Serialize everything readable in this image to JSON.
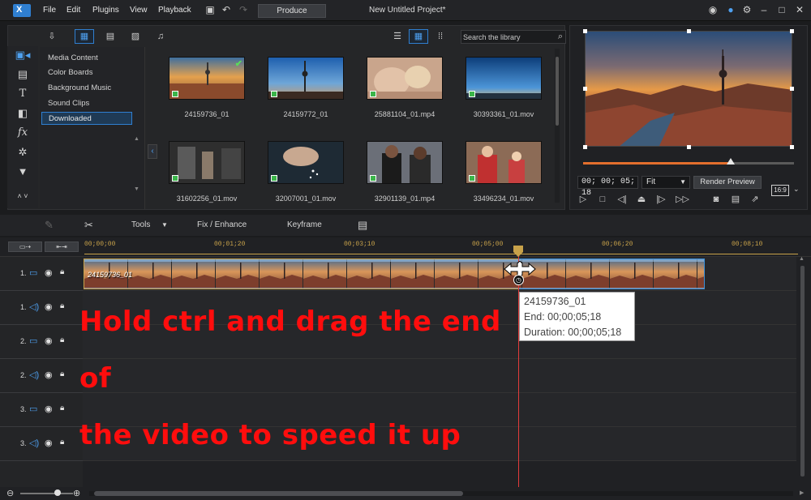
{
  "app": {
    "logo_text": "X",
    "menu": [
      "File",
      "Edit",
      "Plugins",
      "View",
      "Playback"
    ],
    "produce_label": "Produce",
    "project_title": "New Untitled Project*"
  },
  "library": {
    "search_placeholder": "Search the library",
    "tree": [
      "Media Content",
      "Color Boards",
      "Background Music",
      "Sound Clips",
      "Downloaded"
    ],
    "selected_tree_item": "Downloaded",
    "media": [
      {
        "label": "24159736_01",
        "theme": "sunset-city",
        "checked": true
      },
      {
        "label": "24159772_01",
        "theme": "blue-tower",
        "checked": false
      },
      {
        "label": "25881104_01.mp4",
        "theme": "puppy",
        "checked": false
      },
      {
        "label": "30393361_01.mov",
        "theme": "sky",
        "checked": false
      },
      {
        "label": "31602256_01.mov",
        "theme": "gym",
        "checked": false
      },
      {
        "label": "32007001_01.mov",
        "theme": "salt",
        "checked": false
      },
      {
        "label": "32901139_01.mp4",
        "theme": "graduation",
        "checked": false
      },
      {
        "label": "33496234_01.mov",
        "theme": "kitchen",
        "checked": false
      }
    ]
  },
  "preview": {
    "timecode": "00; 00; 05; 18",
    "fit_label": "Fit",
    "render_label": "Render Preview",
    "aspect": "16:9",
    "scrub_fraction": 0.7
  },
  "edit_toolbar": {
    "tools_label": "Tools",
    "fix_label": "Fix / Enhance",
    "keyframe_label": "Keyframe"
  },
  "timeline": {
    "ruler": [
      "00;00;00",
      "00;01;20",
      "00;03;10",
      "00;05;00",
      "00;06;20",
      "00;08;10"
    ],
    "tracks": [
      {
        "num": "1.",
        "type": "video"
      },
      {
        "num": "1.",
        "type": "audio"
      },
      {
        "num": "2.",
        "type": "video"
      },
      {
        "num": "2.",
        "type": "audio"
      },
      {
        "num": "3.",
        "type": "video"
      },
      {
        "num": "3.",
        "type": "audio"
      }
    ],
    "clip_label": "24159736_01",
    "tooltip": {
      "name": "24159736_01",
      "end": "End: 00;00;05;18",
      "duration": "Duration: 00;00;05;18"
    },
    "annotation_line1": "Hold ctrl and drag the end of",
    "annotation_line2": "the video to speed it up"
  },
  "colors": {
    "accent": "#2f7fd1",
    "annotation": "#ff0d0d",
    "playhead": "#e23b3b",
    "timecode_gold": "#c8a24a"
  }
}
